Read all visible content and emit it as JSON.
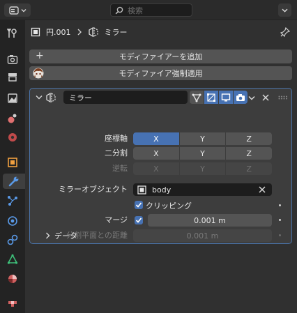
{
  "header": {
    "search_placeholder": "検索"
  },
  "breadcrumb": {
    "object_name": "円.001",
    "modifier_name": "ミラー"
  },
  "actions": {
    "add_modifier": "モディファイアーを追加",
    "force_apply": "モディファイア強制適用"
  },
  "modifier": {
    "name": "ミラー",
    "axis_label": "座標軸",
    "bisect_label": "二分割",
    "flip_label": "逆転",
    "axes": [
      "X",
      "Y",
      "Z"
    ],
    "axis_active": "X",
    "mirror_object_label": "ミラーオブジェクト",
    "mirror_object_value": "body",
    "clipping_label": "クリッピング",
    "clipping_checked": true,
    "merge_label": "マージ",
    "merge_checked": true,
    "merge_value": "0.001 m",
    "bisect_distance_label": "分割平面との距離",
    "bisect_distance_value": "0.001 m",
    "data_subpanel_label": "データ"
  },
  "colors": {
    "accent": "#4772b3",
    "panel_border": "#4a72a8",
    "background": "#303030"
  },
  "sidebar_icons": [
    "tool-icon",
    "render-icon",
    "output-icon",
    "view-layer-icon",
    "scene-icon",
    "world-icon",
    "object-icon",
    "modifier-icon",
    "particles-icon",
    "physics-icon",
    "constraints-icon",
    "data-icon",
    "material-icon",
    "texture-icon"
  ]
}
